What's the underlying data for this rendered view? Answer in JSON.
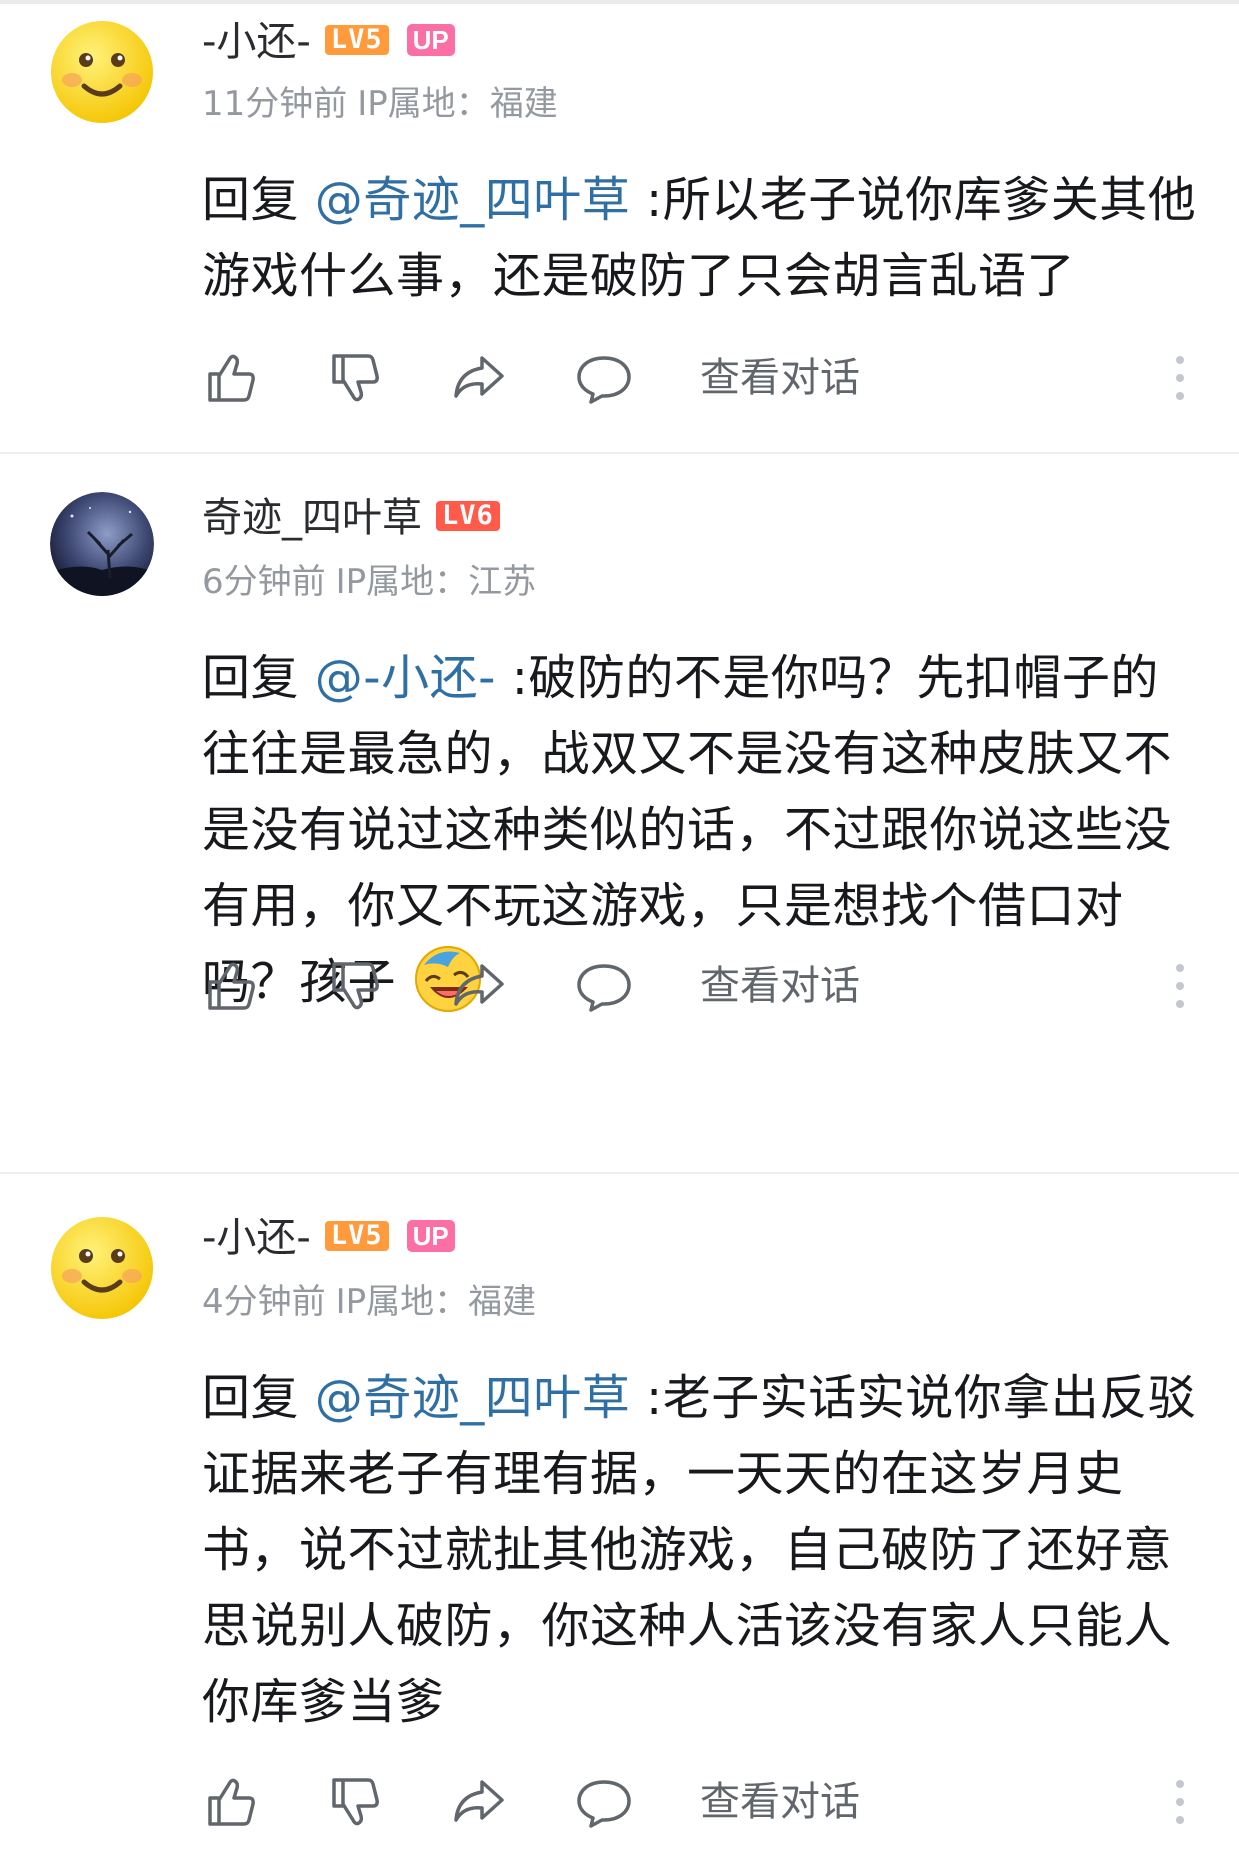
{
  "comments": [
    {
      "username": "-小还-",
      "level": "LV5",
      "up_badge": "UP",
      "time": "11分钟前",
      "ip": "IP属地：福建",
      "reply_prefix": "回复",
      "mention": "@奇迹_四叶草",
      "text": " :所以老子说你库爹关其他游戏什么事，还是破防了只会胡言乱语了",
      "view_conversation": "查看对话"
    },
    {
      "username": "奇迹_四叶草",
      "level": "LV6",
      "time": "6分钟前",
      "ip": "IP属地：江苏",
      "reply_prefix": "回复",
      "mention": "@-小还-",
      "text": " :破防的不是你吗？先扣帽子的往往是最急的，战双又不是没有这种皮肤又不是没有说过这种类似的话，不过跟你说这些没有用，你又不玩这游戏，只是想找个借口对吗？孩子",
      "emoji": "laughing-crying-emoji",
      "view_conversation": "查看对话"
    },
    {
      "username": "-小还-",
      "level": "LV5",
      "up_badge": "UP",
      "time": "4分钟前",
      "ip": "IP属地：福建",
      "reply_prefix": "回复",
      "mention": "@奇迹_四叶草",
      "text": " :老子实话实说你拿出反驳证据来老子有理有据，一天天的在这岁月史书，说不过就扯其他游戏，自己破防了还好意思说别人破防，你这种人活该没有家人只能人你库爹当爹",
      "view_conversation": "查看对话"
    }
  ],
  "icons": {
    "like": "thumbs-up-icon",
    "dislike": "thumbs-down-icon",
    "share": "share-icon",
    "reply": "comment-bubble-icon",
    "more": "more-vertical-icon"
  },
  "colors": {
    "mention": "#2f6fa4",
    "lv5": "#ff9a3d",
    "lv6": "#ff5a4a",
    "up_badge": "#fb6fa4",
    "meta_text": "#9499a0"
  }
}
